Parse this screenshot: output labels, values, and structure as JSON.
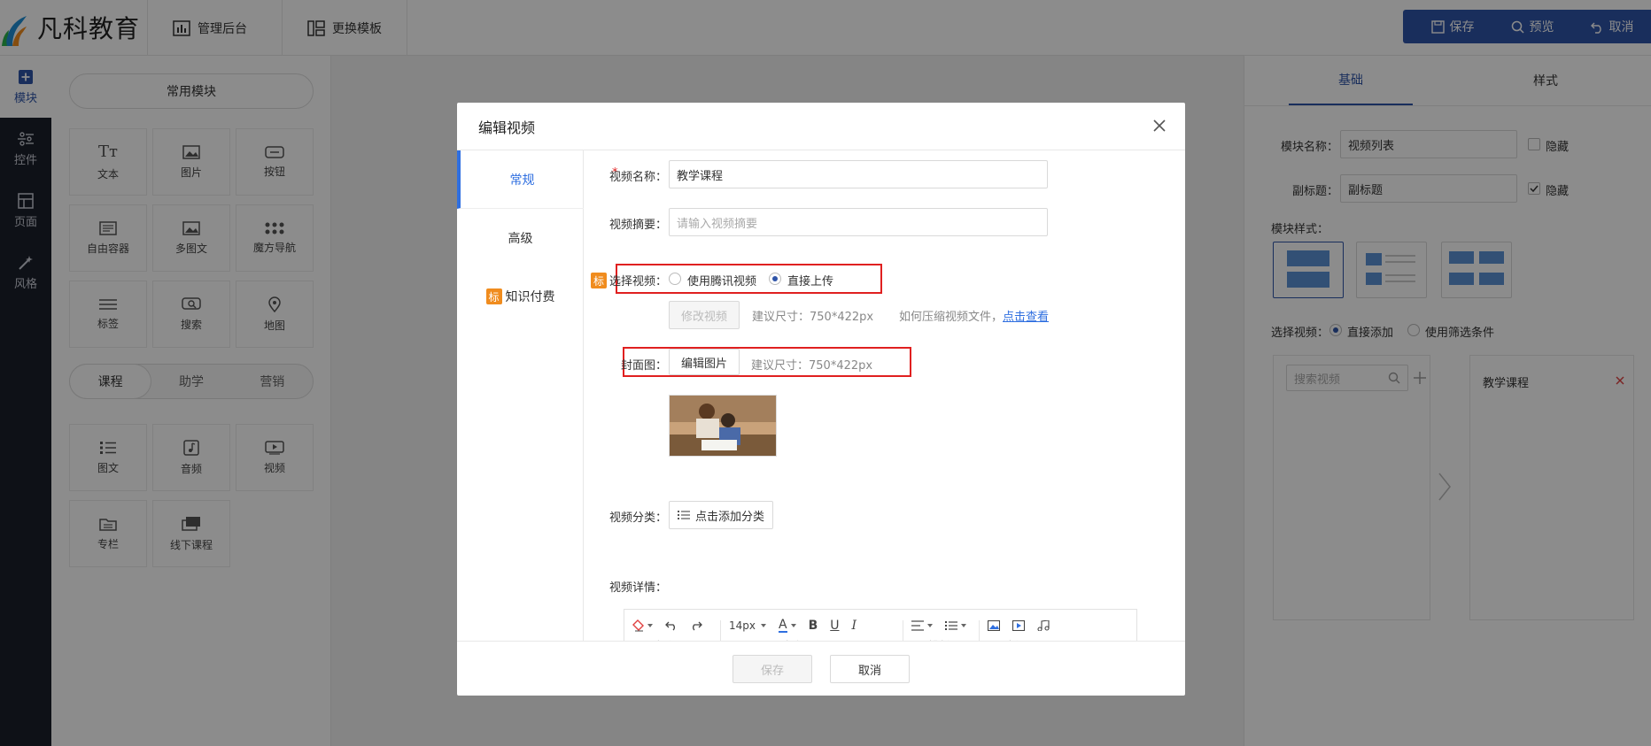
{
  "header": {
    "logo_text": "凡科教育",
    "nav": [
      {
        "label": "管理后台",
        "icon": "bar-chart-icon"
      },
      {
        "label": "更换模板",
        "icon": "template-icon"
      }
    ],
    "actions": [
      {
        "label": "保存",
        "icon": "save-icon"
      },
      {
        "label": "预览",
        "icon": "search-icon"
      },
      {
        "label": "取消",
        "icon": "undo-icon"
      }
    ]
  },
  "rail": {
    "items": [
      {
        "label": "模块",
        "icon": "plus-square-icon"
      },
      {
        "label": "控件",
        "icon": "controls-icon"
      },
      {
        "label": "页面",
        "icon": "page-icon"
      },
      {
        "label": "风格",
        "icon": "magic-wand-icon"
      }
    ]
  },
  "modules": {
    "common_label": "常用模块",
    "common": [
      {
        "label": "文本",
        "icon": "text-icon"
      },
      {
        "label": "图片",
        "icon": "image-icon"
      },
      {
        "label": "按钮",
        "icon": "button-icon"
      },
      {
        "label": "自由容器",
        "icon": "container-icon"
      },
      {
        "label": "多图文",
        "icon": "multi-image-icon"
      },
      {
        "label": "魔方导航",
        "icon": "grid-dots-icon"
      },
      {
        "label": "标签",
        "icon": "tags-icon"
      },
      {
        "label": "搜索",
        "icon": "search-box-icon"
      },
      {
        "label": "地图",
        "icon": "map-pin-icon"
      }
    ],
    "tabs": [
      "课程",
      "助学",
      "营销"
    ],
    "course": [
      {
        "label": "图文",
        "icon": "list-icon"
      },
      {
        "label": "音频",
        "icon": "music-icon"
      },
      {
        "label": "视频",
        "icon": "video-icon"
      },
      {
        "label": "专栏",
        "icon": "folder-icon"
      },
      {
        "label": "线下课程",
        "icon": "offline-course-icon"
      }
    ]
  },
  "right_panel": {
    "tabs": [
      "基础",
      "样式"
    ],
    "module_name_label": "模块名称：",
    "module_name_value": "视频列表",
    "hide_label_1": "隐藏",
    "subtitle_label": "副标题：",
    "subtitle_value": "副标题",
    "hide_label_2": "隐藏",
    "style_label": "模块样式：",
    "choose_video_label": "选择视频：",
    "option_direct": "直接添加",
    "option_filter": "使用筛选条件",
    "search_placeholder": "搜索视频",
    "selected_item": "教学课程"
  },
  "modal": {
    "title": "编辑视频",
    "tabs": [
      {
        "label": "常规"
      },
      {
        "label": "高级"
      },
      {
        "label": "知识付费",
        "badge": "标"
      }
    ],
    "form": {
      "name_label": "视频名称：",
      "name_value": "教学课程",
      "summary_label": "视频摘要：",
      "summary_placeholder": "请输入视频摘要",
      "badge": "标",
      "choose_label": "选择视频：",
      "option_tencent": "使用腾讯视频",
      "option_upload": "直接上传",
      "modify_btn": "修改视频",
      "size_hint": "建议尺寸：750*422px",
      "compress_hint": "如何压缩视频文件，",
      "compress_link": "点击查看",
      "cover_label": "封面图：",
      "edit_image_btn": "编辑图片",
      "cover_hint": "建议尺寸：750*422px",
      "category_label": "视频分类：",
      "category_btn": "点击添加分类",
      "detail_label": "视频详情："
    },
    "editor": {
      "font_size": "14px",
      "groups": [
        "操作",
        "文字",
        "排版",
        "插入"
      ]
    },
    "footer": {
      "save": "保存",
      "cancel": "取消"
    }
  }
}
